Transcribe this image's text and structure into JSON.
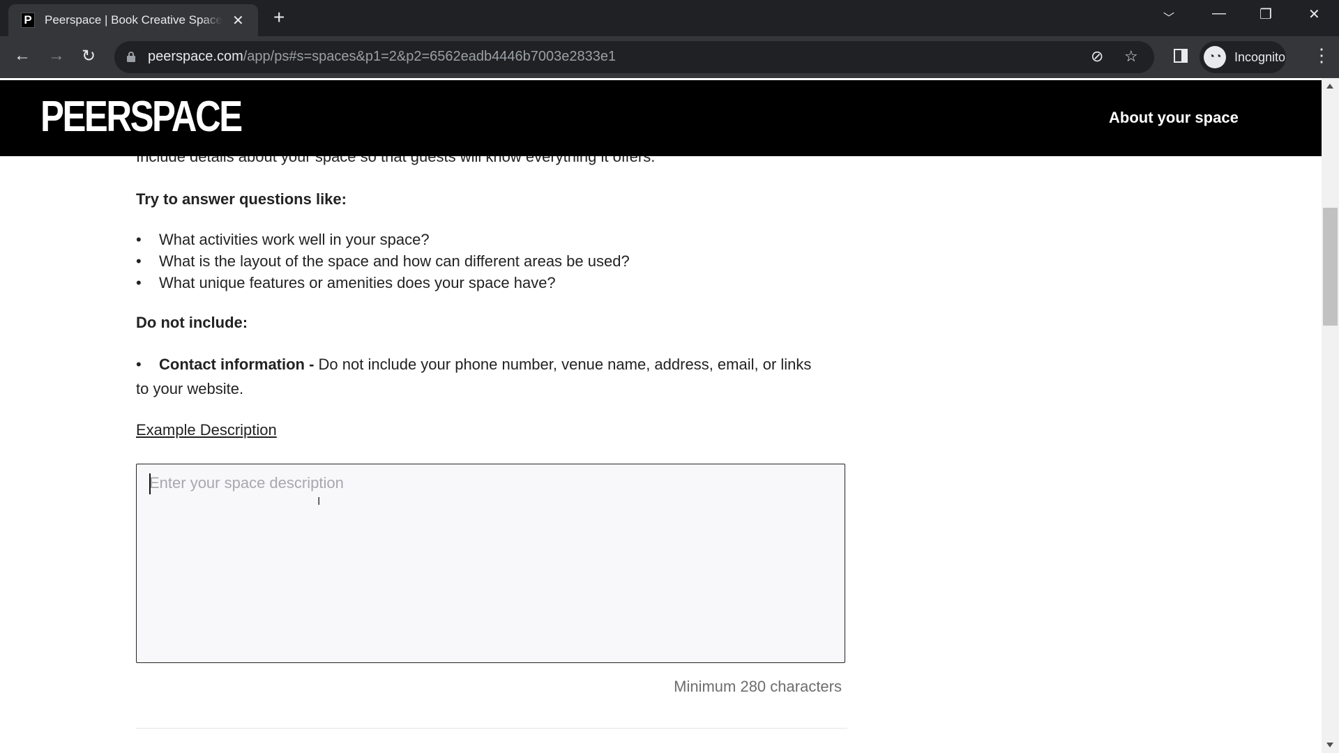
{
  "browser": {
    "tab_title": "Peerspace | Book Creative Spaces",
    "favicon_letter": "P",
    "url_host": "peerspace.com",
    "url_path": "/app/ps#s=spaces&p1=2&p2=6562eadb4446b7003e2833e1",
    "profile_label": "Incognito"
  },
  "header": {
    "logo": "PEERSPACE",
    "title": "About your space"
  },
  "main": {
    "intro": "Include details about your space so that guests will know everything it offers.",
    "questions_heading": "Try to answer questions like:",
    "questions": [
      "What activities work well in your space?",
      "What is the layout of the space and how can different areas be used?",
      "What unique features or amenities does your space have?"
    ],
    "exclude_heading": "Do not include:",
    "exclude_item_bold": "Contact information - ",
    "exclude_item_text": "Do not include your phone number, venue name, address, email, or links",
    "exclude_item_wrap": "to your website.",
    "example_link": "Example Description",
    "description_value": "",
    "description_placeholder": "Enter your space description",
    "min_chars_hint": "Minimum 280 characters"
  }
}
